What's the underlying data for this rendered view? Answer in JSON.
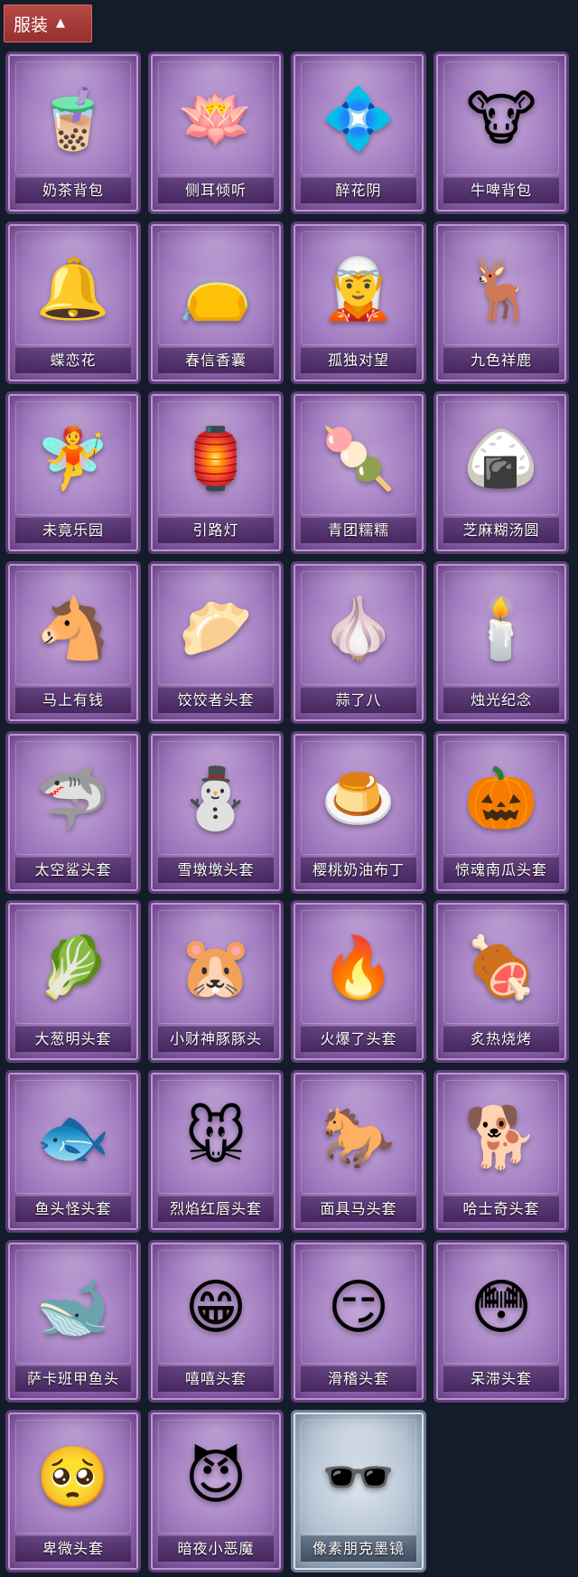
{
  "header": {
    "tab_label": "服装",
    "chevron_icon": "chevron-up-icon"
  },
  "items": [
    {
      "name": "奶茶背包",
      "icon": "🧋"
    },
    {
      "name": "侧耳倾听",
      "icon": "🪷"
    },
    {
      "name": "醉花阴",
      "icon": "💠"
    },
    {
      "name": "牛啤背包",
      "icon": "🐮"
    },
    {
      "name": "蝶恋花",
      "icon": "🔔"
    },
    {
      "name": "春信香囊",
      "icon": "👝"
    },
    {
      "name": "孤独对望",
      "icon": "🧝"
    },
    {
      "name": "九色祥鹿",
      "icon": "🦌"
    },
    {
      "name": "未竟乐园",
      "icon": "🧚"
    },
    {
      "name": "引路灯",
      "icon": "🏮"
    },
    {
      "name": "青团糯糯",
      "icon": "🍡"
    },
    {
      "name": "芝麻糊汤圆",
      "icon": "🍙"
    },
    {
      "name": "马上有钱",
      "icon": "🐴"
    },
    {
      "name": "饺饺者头套",
      "icon": "🥟"
    },
    {
      "name": "蒜了八",
      "icon": "🧄"
    },
    {
      "name": "烛光纪念",
      "icon": "🕯️"
    },
    {
      "name": "太空鲨头套",
      "icon": "🦈"
    },
    {
      "name": "雪墩墩头套",
      "icon": "⛄"
    },
    {
      "name": "樱桃奶油布丁",
      "icon": "🍮"
    },
    {
      "name": "惊魂南瓜头套",
      "icon": "🎃"
    },
    {
      "name": "大葱明头套",
      "icon": "🥬"
    },
    {
      "name": "小财神豚豚头",
      "icon": "🐹"
    },
    {
      "name": "火爆了头套",
      "icon": "🔥"
    },
    {
      "name": "炙热烧烤",
      "icon": "🍖"
    },
    {
      "name": "鱼头怪头套",
      "icon": "🐟"
    },
    {
      "name": "烈焰红唇头套",
      "icon": "🐭"
    },
    {
      "name": "面具马头套",
      "icon": "🐎"
    },
    {
      "name": "哈士奇头套",
      "icon": "🐕"
    },
    {
      "name": "萨卡班甲鱼头",
      "icon": "🐋"
    },
    {
      "name": "嘻嘻头套",
      "icon": "😁"
    },
    {
      "name": "滑稽头套",
      "icon": "😏"
    },
    {
      "name": "呆滞头套",
      "icon": "😳"
    },
    {
      "name": "卑微头套",
      "icon": "🥺"
    },
    {
      "name": "暗夜小恶魔",
      "icon": "😈"
    },
    {
      "name": "像素朋克墨镜",
      "icon": "🕶️",
      "style": "pixel"
    }
  ]
}
